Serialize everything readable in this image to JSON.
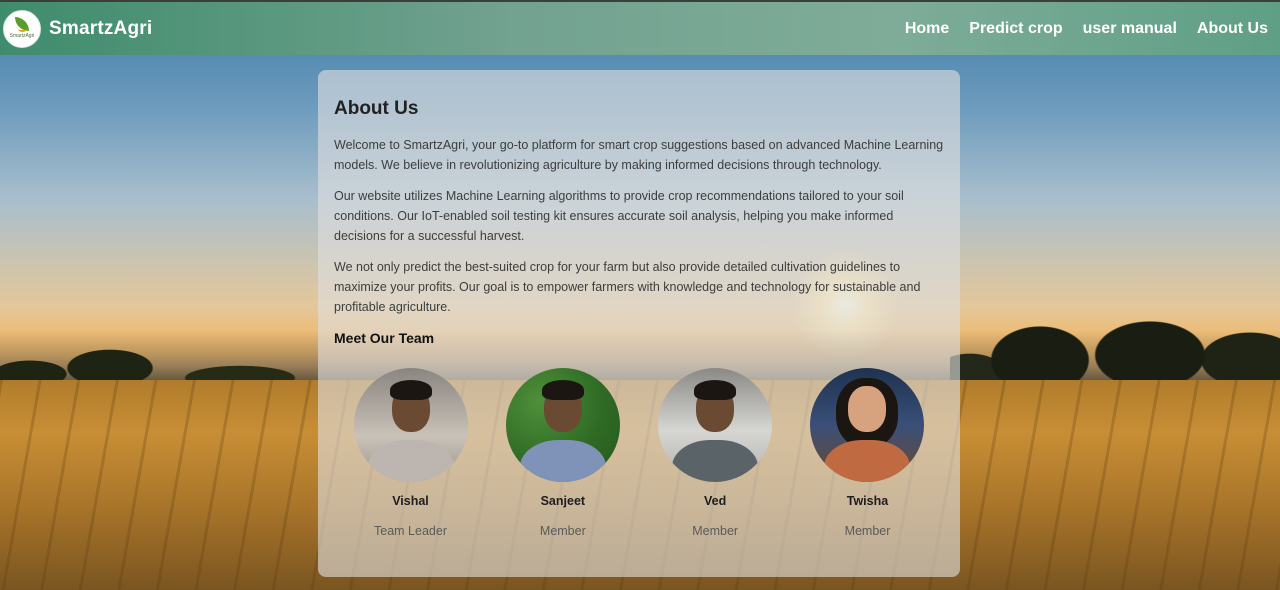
{
  "navbar": {
    "brand": "SmartzAgri",
    "logo_text": "SmartzAgri",
    "links": [
      "Home",
      "Predict crop",
      "user manual",
      "About Us"
    ]
  },
  "about": {
    "title": "About Us",
    "paragraphs": [
      "Welcome to SmartzAgri, your go-to platform for smart crop suggestions based on advanced Machine Learning models. We believe in revolutionizing agriculture by making informed decisions through technology.",
      "Our website utilizes Machine Learning algorithms to provide crop recommendations tailored to your soil conditions. Our IoT-enabled soil testing kit ensures accurate soil analysis, helping you make informed decisions for a successful harvest.",
      "We not only predict the best-suited crop for your farm but also provide detailed cultivation guidelines to maximize your profits. Our goal is to empower farmers with knowledge and technology for sustainable and profitable agriculture."
    ],
    "team_heading": "Meet Our Team",
    "team": [
      {
        "name": "Vishal",
        "role": "Team Leader"
      },
      {
        "name": "Sanjeet",
        "role": "Member"
      },
      {
        "name": "Ved",
        "role": "Member"
      },
      {
        "name": "Twisha",
        "role": "Member"
      }
    ]
  },
  "colors": {
    "navbar_start": "#3f8c6c",
    "navbar_end": "#7eac98",
    "nav_text": "#ffffff"
  }
}
